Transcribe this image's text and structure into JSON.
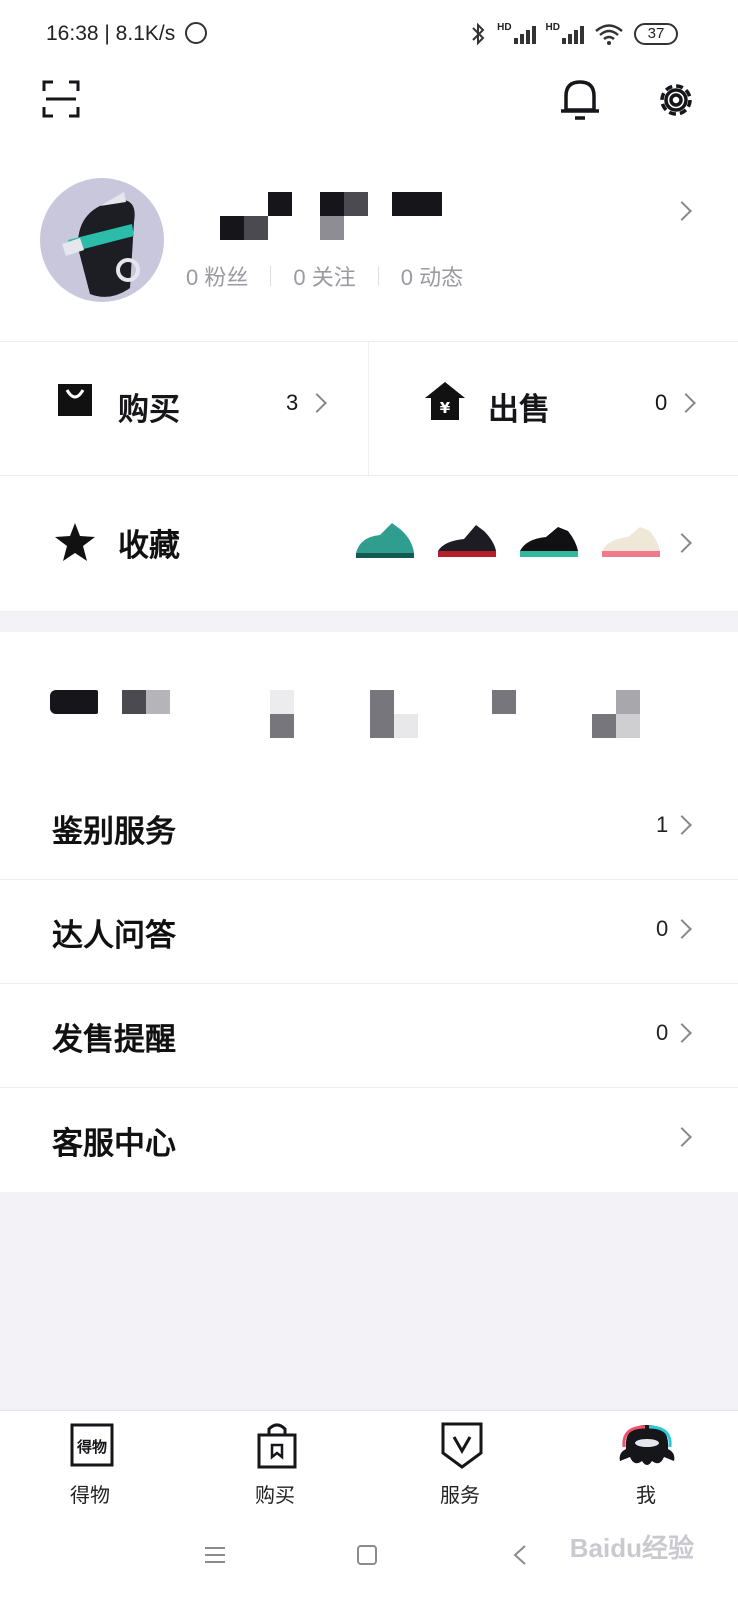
{
  "status_bar": {
    "time": "16:38 | 8.1K/s",
    "battery": "37",
    "hd1": "HD",
    "hd2": "HD"
  },
  "header": {
    "icons": [
      "scan-icon",
      "bell-icon",
      "gear-icon"
    ]
  },
  "profile": {
    "fans": "0 粉丝",
    "following": "0 关注",
    "posts": "0 动态"
  },
  "buy": {
    "label": "购买",
    "count": "3"
  },
  "sell": {
    "label": "出售",
    "count": "0"
  },
  "favorites": {
    "label": "收藏",
    "shoes": [
      {
        "color": "#2f9e8f",
        "accent": "#135a55"
      },
      {
        "color": "#1c1c22",
        "accent": "#b3202c"
      },
      {
        "color": "#111114",
        "accent": "#32b89d"
      },
      {
        "color": "#efe8d8",
        "accent": "#f07a8a"
      }
    ]
  },
  "menu": [
    {
      "label": "鉴别服务",
      "count": "1"
    },
    {
      "label": "达人问答",
      "count": "0"
    },
    {
      "label": "发售提醒",
      "count": "0"
    },
    {
      "label": "客服中心",
      "count": ""
    }
  ],
  "tabs": [
    {
      "label": "得物",
      "icon": "dewu-logo-icon"
    },
    {
      "label": "购买",
      "icon": "shopping-bag-icon"
    },
    {
      "label": "服务",
      "icon": "shield-v-icon"
    },
    {
      "label": "我",
      "icon": "octopus-avatar-icon"
    }
  ],
  "watermark": "Baidu经验",
  "colors": {
    "background": "#f3f2f7",
    "card": "#ffffff",
    "text": "#16161a",
    "muted": "#9a9aa2"
  }
}
